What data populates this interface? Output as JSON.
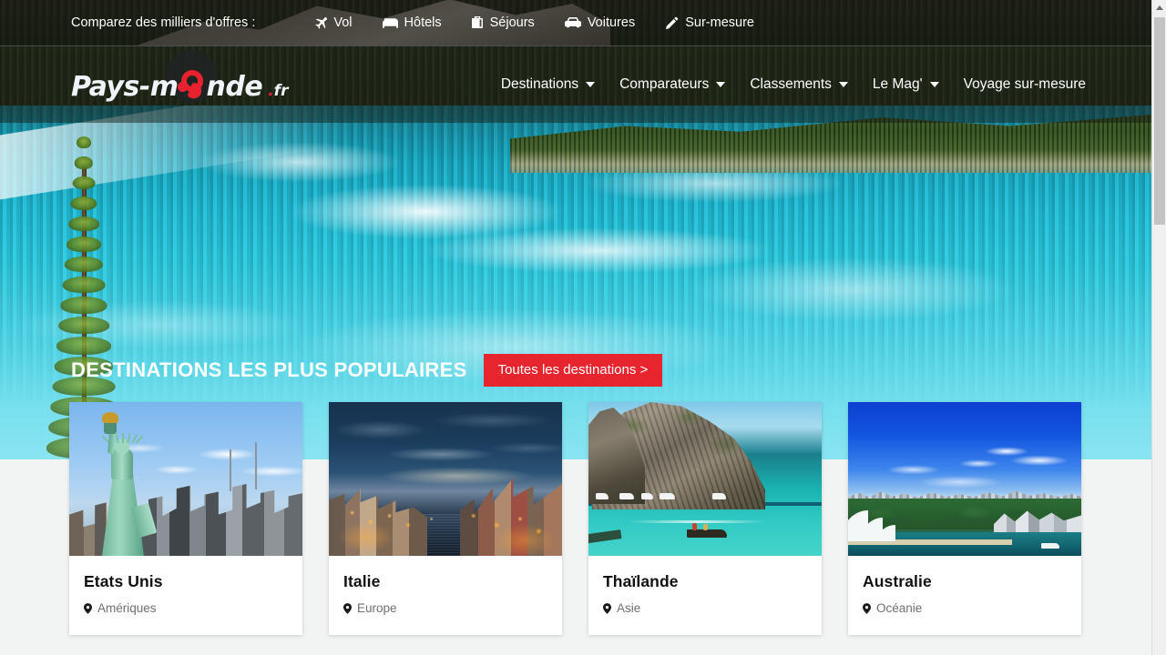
{
  "topbar": {
    "label": "Comparez des milliers d'offres :",
    "links": [
      {
        "label": "Vol",
        "icon": "plane-icon"
      },
      {
        "label": "Hôtels",
        "icon": "bed-icon"
      },
      {
        "label": "Séjours",
        "icon": "suitcase-icon"
      },
      {
        "label": "Voitures",
        "icon": "car-icon"
      },
      {
        "label": "Sur-mesure",
        "icon": "pencil-icon"
      }
    ]
  },
  "header": {
    "logo": {
      "part1": "Pays-m",
      "part2": "nde",
      "suffix": "fr",
      "dot": "."
    },
    "nav": [
      {
        "label": "Destinations",
        "has_caret": true
      },
      {
        "label": "Comparateurs",
        "has_caret": true
      },
      {
        "label": "Classements",
        "has_caret": true
      },
      {
        "label": "Le Mag'",
        "has_caret": true
      },
      {
        "label": "Voyage sur-mesure",
        "has_caret": false
      }
    ]
  },
  "hero": {
    "title": "DESTINATIONS LES PLUS POPULAIRES",
    "button_label": "Toutes les destinations >",
    "button_color": "#e6252f"
  },
  "cards": [
    {
      "title": "Etats Unis",
      "region": "Amériques",
      "image": "statue-of-liberty-new-york-photo"
    },
    {
      "title": "Italie",
      "region": "Europe",
      "image": "venice-grand-canal-dusk-photo"
    },
    {
      "title": "Thaïlande",
      "region": "Asie",
      "image": "maya-bay-limestone-cliff-photo"
    },
    {
      "title": "Australie",
      "region": "Océanie",
      "image": "sydney-harbour-opera-house-photo"
    }
  ],
  "scrollbar": {
    "up_arrow": "scroll-up-arrow",
    "thumb": "scroll-thumb"
  }
}
